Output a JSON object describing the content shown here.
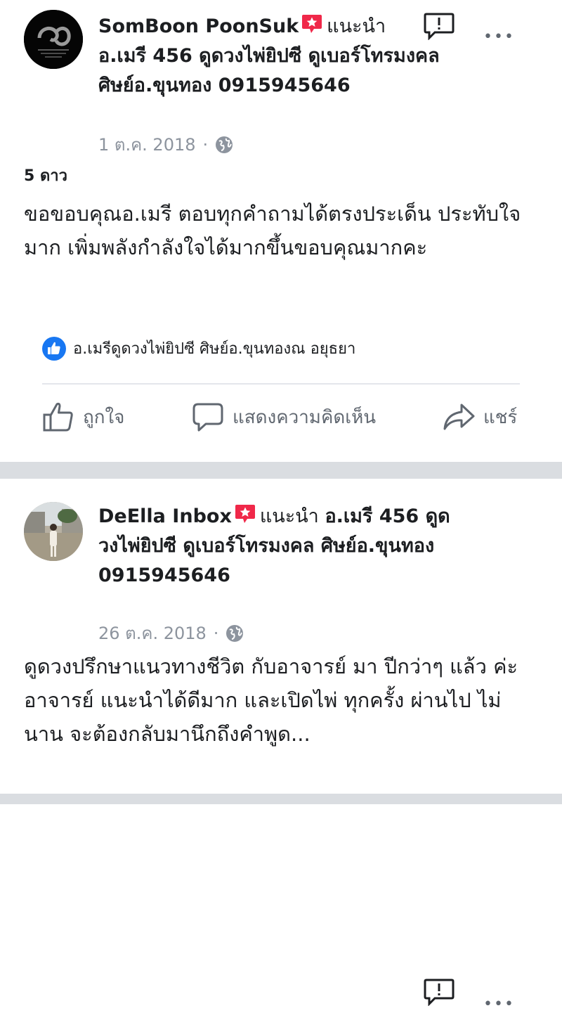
{
  "posts": [
    {
      "author": "SomBoon PoonSuk",
      "recommends": "แนะนำ",
      "page_name": "อ.เมรี 456 ดูดวงไพ่ยิปซี ดูเบอร์โทรมงคล ศิษย์อ.ขุนทอง 0915945646",
      "date": "1 ต.ค. 2018",
      "separator": "·",
      "rating": "5 ดาว",
      "text": "ขอขอบคุณอ.เมรี ตอบทุกคำถามได้ตรงประเด็น ประทับใจมาก เพิ่มพลังกำลังใจได้มากขึ้นขอบคุณมากคะ",
      "likers": "อ.เมรีดูดวงไพ่ยิปซี ศิษย์อ.ขุนทองณ อยุธยา",
      "more_label": "•••"
    },
    {
      "author": "DeElla Inbox",
      "recommends": "แนะนำ",
      "page_name": "อ.เมรี 456 ดูดวงไพ่ยิปซี ดูเบอร์โทรมงคล ศิษย์อ.ขุนทอง 0915945646",
      "date": "26 ต.ค. 2018",
      "separator": "·",
      "text": "ดูดวงปรึกษาแนวทางชีวิต กับอาจารย์ มา ปีกว่าๆ แล้ว ค่ะ อาจารย์ แนะนำได้ดีมาก และเปิดไพ่ ทุกครั้ง ผ่านไป ไม่นาน จะต้องกลับมานึกถึงคำพูด...",
      "more_label": "•••"
    }
  ],
  "actions": {
    "like": "ถูกใจ",
    "comment": "แสดงความคิดเห็น",
    "share": "แชร์"
  },
  "colors": {
    "badge": "#f02849",
    "like_blue": "#1877f2",
    "muted": "#606770",
    "separator_bg": "#dadde1"
  },
  "icons": [
    "recommend-badge-icon",
    "report-icon",
    "more-options-icon",
    "globe-icon",
    "like-thumb-icon",
    "comment-icon",
    "share-icon"
  ]
}
